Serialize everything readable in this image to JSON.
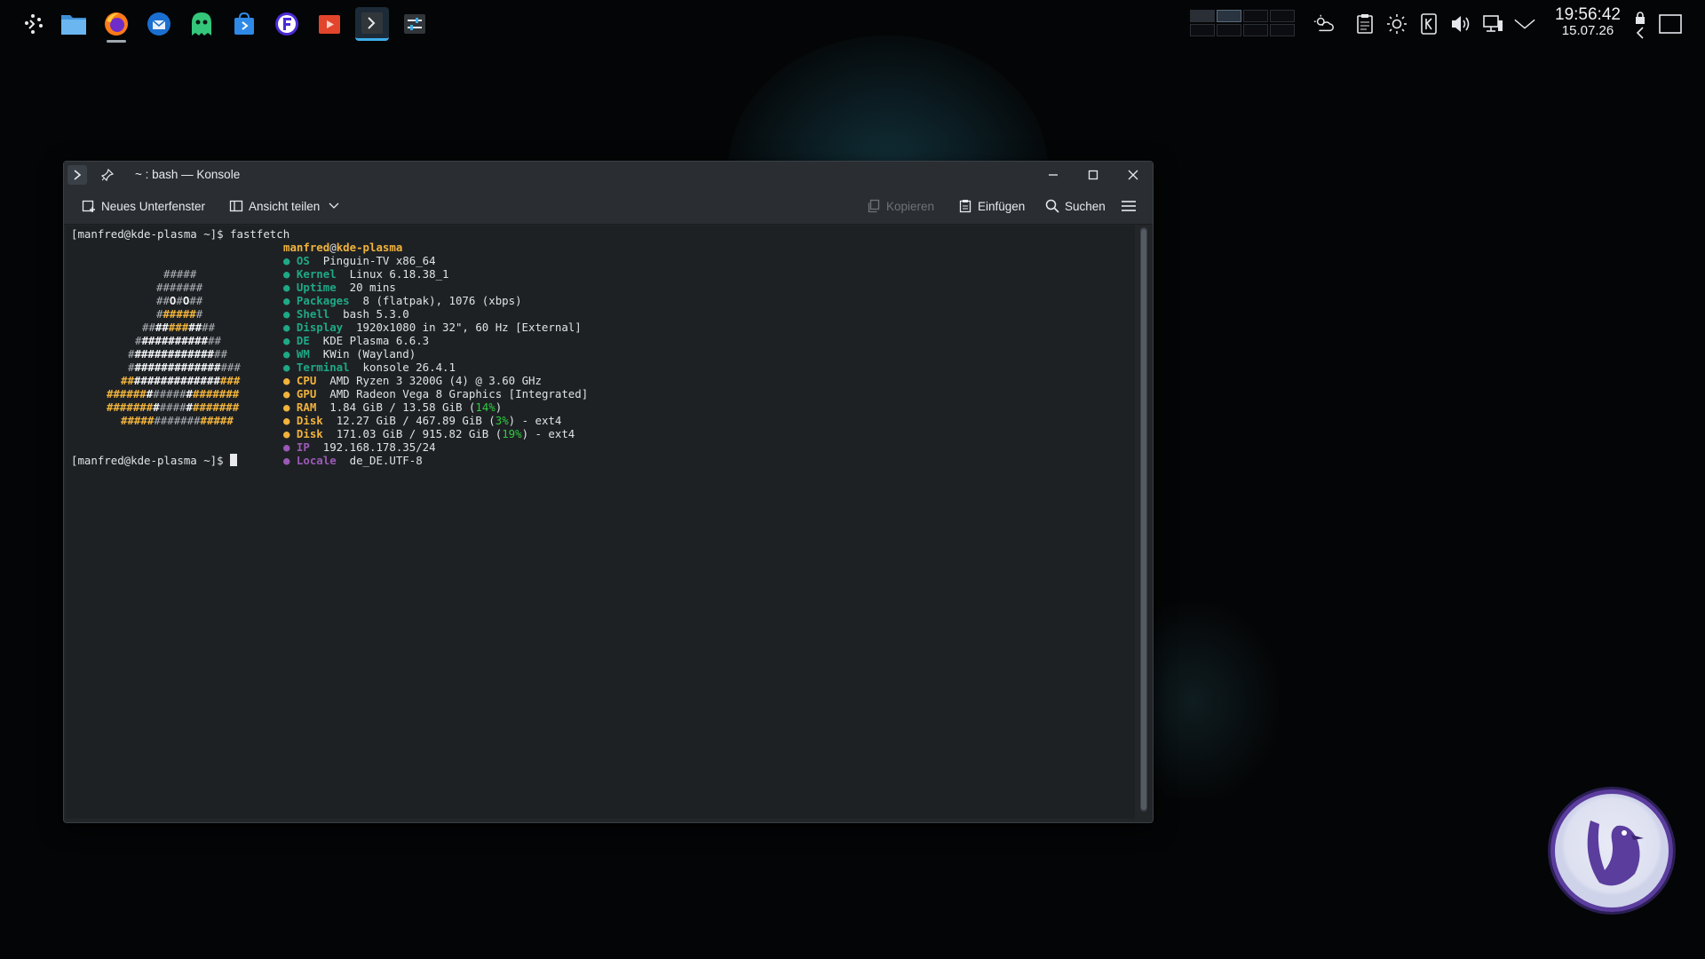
{
  "taskbar": {
    "launchers": [
      {
        "name": "application-launcher",
        "icon": "kde-launcher-icon"
      },
      {
        "name": "dolphin",
        "icon": "folder-icon"
      },
      {
        "name": "firefox",
        "icon": "firefox-icon"
      },
      {
        "name": "thunderbird",
        "icon": "mail-icon"
      },
      {
        "name": "ghost-app",
        "icon": "ghost-icon"
      },
      {
        "name": "discover",
        "icon": "store-icon"
      },
      {
        "name": "app-f",
        "icon": "f-logo-icon"
      },
      {
        "name": "video-app",
        "icon": "video-icon"
      },
      {
        "name": "konsole",
        "icon": "terminal-icon"
      },
      {
        "name": "settings-app",
        "icon": "sliders-icon"
      }
    ],
    "clock": {
      "time": "19:56:42",
      "date": "15.07.26"
    }
  },
  "window": {
    "title": "~ : bash — Konsole",
    "toolbar": {
      "new_tab": "Neues Unterfenster",
      "split_view": "Ansicht teilen",
      "copy": "Kopieren",
      "paste": "Einfügen",
      "search": "Suchen"
    },
    "terminal": {
      "prompt": "[manfred@kde-plasma ~]$",
      "command": "fastfetch",
      "header_user": "manfred",
      "header_host": "kde-plasma",
      "info": [
        {
          "key": "OS",
          "value": "Pinguin-TV x86_64",
          "color": "g"
        },
        {
          "key": "Kernel",
          "value": "Linux 6.18.38_1",
          "color": "g"
        },
        {
          "key": "Uptime",
          "value": "20 mins",
          "color": "g"
        },
        {
          "key": "Packages",
          "value": "8 (flatpak), 1076 (xbps)",
          "color": "g"
        },
        {
          "key": "Shell",
          "value": "bash 5.3.0",
          "color": "g"
        },
        {
          "key": "Display",
          "value": "1920x1080 in 32\", 60 Hz [External]",
          "color": "g"
        },
        {
          "key": "DE",
          "value": "KDE Plasma 6.6.3",
          "color": "g"
        },
        {
          "key": "WM",
          "value": "KWin (Wayland)",
          "color": "g"
        },
        {
          "key": "Terminal",
          "value": "konsole 26.4.1",
          "color": "g"
        },
        {
          "key": "CPU",
          "value": "AMD Ryzen 3 3200G (4) @ 3.60 GHz",
          "color": "y"
        },
        {
          "key": "GPU",
          "value": "AMD Radeon Vega 8 Graphics [Integrated]",
          "color": "y"
        },
        {
          "key": "RAM",
          "value": "1.84 GiB / 13.58 GiB (",
          "pct": "14%",
          "tail": ")",
          "color": "y"
        },
        {
          "key": "Disk",
          "value": "12.27 GiB / 467.89 GiB (",
          "pct": "3%",
          "tail": ") - ext4",
          "color": "y"
        },
        {
          "key": "Disk",
          "value": "171.03 GiB / 915.82 GiB (",
          "pct": "19%",
          "tail": ") - ext4",
          "color": "y"
        },
        {
          "key": "IP",
          "value": "192.168.178.35/24",
          "color": "p"
        },
        {
          "key": "Locale",
          "value": "de_DE.UTF-8",
          "color": "p"
        }
      ]
    }
  },
  "colors": {
    "accent": "#3daee9",
    "green": "#1fa886",
    "yellow": "#f0b33c",
    "purple": "#9b59b6",
    "percent": "#2ecc40"
  }
}
